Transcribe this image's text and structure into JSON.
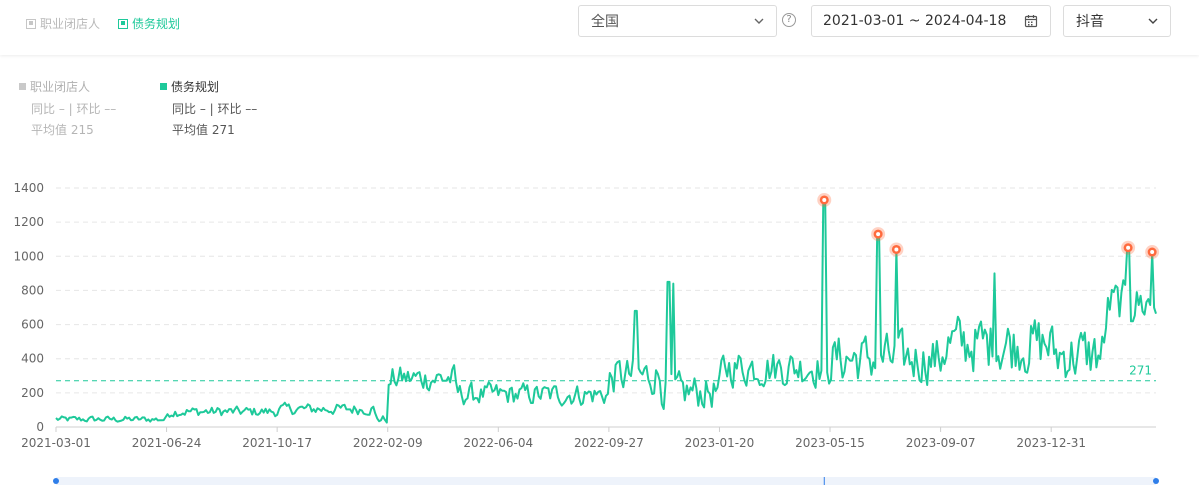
{
  "toolbar": {
    "toggle_inactive": "职业闭店人",
    "toggle_active": "债务规划",
    "region": "全国",
    "help": "?",
    "date_range": "2021-03-01 ~ 2024-04-18",
    "platform": "抖音"
  },
  "legend": {
    "series_a": {
      "name": "职业闭店人",
      "yoy": "同比 – | 环比 ––",
      "avg": "平均值 215"
    },
    "series_b": {
      "name": "债务规划",
      "yoy": "同比 – | 环比 ––",
      "avg": "平均值 271"
    }
  },
  "colors": {
    "accent": "#1ec99a",
    "peak": "#ff6a3d",
    "grid": "#e6e6e6"
  },
  "chart_data": {
    "type": "line",
    "ylim": [
      0,
      1400
    ],
    "yticks": [
      0,
      200,
      400,
      600,
      800,
      1000,
      1200,
      1400
    ],
    "x_start": "2021-03-01",
    "x_end": "2024-04-18",
    "xticks": [
      "2021-03-01",
      "2021-06-24",
      "2021-10-17",
      "2022-02-09",
      "2022-06-04",
      "2022-09-27",
      "2023-01-20",
      "2023-05-15",
      "2023-09-07",
      "2023-12-31"
    ],
    "average": 271,
    "average_label": "271",
    "grid": true,
    "series": [
      {
        "name": "债务规划",
        "segments": [
          {
            "from": "2021-03-01",
            "to": "2021-06-24",
            "min": 20,
            "max": 70
          },
          {
            "from": "2021-06-24",
            "to": "2021-10-17",
            "min": 50,
            "max": 130
          },
          {
            "from": "2021-10-17",
            "to": "2022-01-25",
            "min": 60,
            "max": 150
          },
          {
            "from": "2022-01-25",
            "to": "2022-02-09",
            "min": 10,
            "max": 80
          },
          {
            "from": "2022-02-09",
            "to": "2022-04-20",
            "min": 180,
            "max": 390
          },
          {
            "from": "2022-04-20",
            "to": "2022-09-27",
            "min": 100,
            "max": 280
          },
          {
            "from": "2022-09-27",
            "to": "2022-11-20",
            "min": 150,
            "max": 450
          },
          {
            "from": "2022-11-20",
            "to": "2023-01-20",
            "min": 60,
            "max": 350
          },
          {
            "from": "2023-01-20",
            "to": "2023-05-15",
            "min": 200,
            "max": 500
          },
          {
            "from": "2023-05-15",
            "to": "2023-09-07",
            "min": 200,
            "max": 600
          },
          {
            "from": "2023-09-07",
            "to": "2023-12-31",
            "min": 250,
            "max": 720
          },
          {
            "from": "2023-12-31",
            "to": "2024-02-25",
            "min": 200,
            "max": 650
          },
          {
            "from": "2024-02-25",
            "to": "2024-04-18",
            "min": 550,
            "max": 900
          }
        ],
        "spikes": [
          {
            "date": "2022-10-25",
            "value": 680
          },
          {
            "date": "2022-11-28",
            "value": 850
          },
          {
            "date": "2022-12-03",
            "value": 840
          },
          {
            "date": "2023-05-09",
            "value": 1330
          },
          {
            "date": "2023-07-04",
            "value": 1130
          },
          {
            "date": "2023-07-23",
            "value": 1040
          },
          {
            "date": "2023-11-02",
            "value": 900
          },
          {
            "date": "2024-03-20",
            "value": 1050
          },
          {
            "date": "2024-04-14",
            "value": 1025
          }
        ],
        "peaks": [
          {
            "date": "2023-05-09",
            "value": 1330
          },
          {
            "date": "2023-07-04",
            "value": 1130
          },
          {
            "date": "2023-07-23",
            "value": 1040
          },
          {
            "date": "2024-03-20",
            "value": 1050
          },
          {
            "date": "2024-04-14",
            "value": 1025
          }
        ]
      }
    ]
  }
}
